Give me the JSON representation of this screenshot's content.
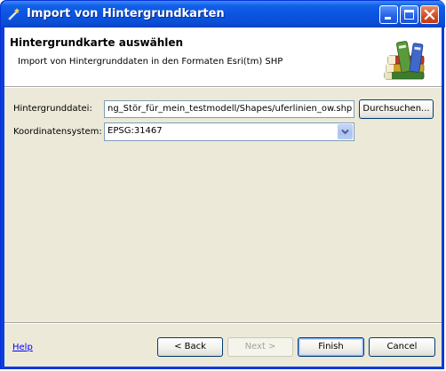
{
  "window": {
    "title": "Import von Hintergrundkarten",
    "icon": "app-wizard-icon"
  },
  "title_buttons": {
    "minimize_icon": "minimize-icon",
    "maximize_icon": "maximize-icon",
    "close_icon": "close-icon"
  },
  "header": {
    "title": "Hintergrundkarte auswählen",
    "description": "Import von Hintergrunddaten in den Formaten Esri(tm) SHP",
    "image": "books-icon"
  },
  "form": {
    "file_label": "Hintergrunddatei:",
    "file_value": "ng_Stör_für_mein_testmodell/Shapes/uferlinien_ow.shp",
    "browse_label": "Durchsuchen...",
    "crs_label": "Koordinatensystem:",
    "crs_value": "EPSG:31467"
  },
  "footer": {
    "help_label": "Help",
    "back_label": "< Back",
    "next_label": "Next >",
    "finish_label": "Finish",
    "cancel_label": "Cancel"
  },
  "colors": {
    "titlebar": "#0a54e3",
    "dialog_bg": "#ece9d8",
    "link": "#0000ff"
  }
}
